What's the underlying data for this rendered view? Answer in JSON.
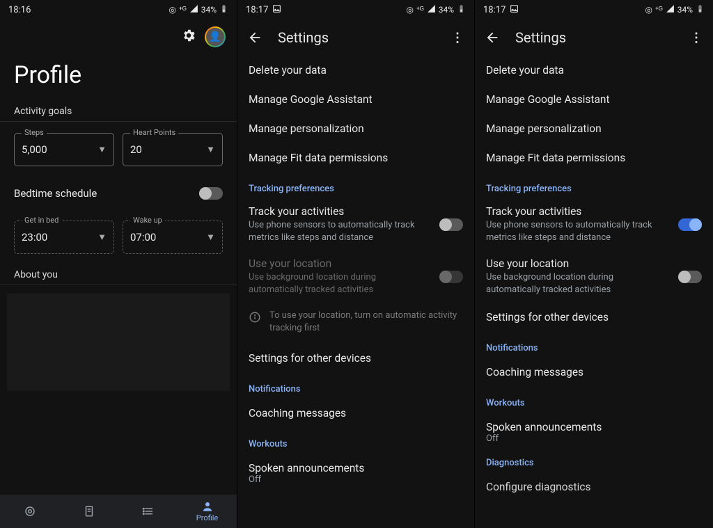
{
  "pane1": {
    "status": {
      "time": "18:16",
      "battery": "34%"
    },
    "title": "Profile",
    "activity_goals_label": "Activity goals",
    "steps": {
      "label": "Steps",
      "value": "5,000"
    },
    "heart": {
      "label": "Heart Points",
      "value": "20"
    },
    "bedtime": {
      "label": "Bedtime schedule"
    },
    "getinbed": {
      "label": "Get in bed",
      "value": "23:00"
    },
    "wakeup": {
      "label": "Wake up",
      "value": "07:00"
    },
    "about_label": "About you",
    "nav_profile": "Profile"
  },
  "pane2": {
    "status": {
      "time": "18:17",
      "battery": "34%"
    },
    "title": "Settings",
    "items": [
      "Delete your data",
      "Manage Google Assistant",
      "Manage personalization",
      "Manage Fit data permissions"
    ],
    "tracking_header": "Tracking preferences",
    "track_activities": {
      "title": "Track your activities",
      "sub": "Use phone sensors to automatically track metrics like steps and distance"
    },
    "use_location": {
      "title": "Use your location",
      "sub": "Use background location during automatically tracked activities"
    },
    "info": "To use your location, turn on automatic activity tracking first",
    "other_devices": "Settings for other devices",
    "notifications_header": "Notifications",
    "coaching": "Coaching messages",
    "workouts_header": "Workouts",
    "spoken": {
      "title": "Spoken announcements",
      "sub": "Off"
    }
  },
  "pane3": {
    "status": {
      "time": "18:17",
      "battery": "34%"
    },
    "title": "Settings",
    "items": [
      "Delete your data",
      "Manage Google Assistant",
      "Manage personalization",
      "Manage Fit data permissions"
    ],
    "tracking_header": "Tracking preferences",
    "track_activities": {
      "title": "Track your activities",
      "sub": "Use phone sensors to automatically track metrics like steps and distance"
    },
    "use_location": {
      "title": "Use your location",
      "sub": "Use background location during automatically tracked activities"
    },
    "other_devices": "Settings for other devices",
    "notifications_header": "Notifications",
    "coaching": "Coaching messages",
    "workouts_header": "Workouts",
    "spoken": {
      "title": "Spoken announcements",
      "sub": "Off"
    },
    "diagnostics_header": "Diagnostics",
    "configure_diag": "Configure diagnostics"
  }
}
